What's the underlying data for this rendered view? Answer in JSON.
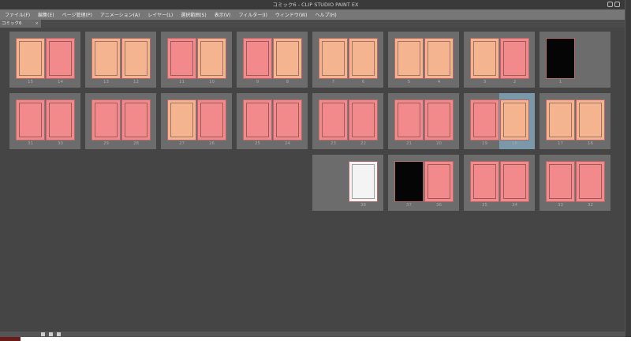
{
  "window": {
    "title": "コミック6 - CLIP STUDIO PAINT EX"
  },
  "menu": [
    "ファイル(F)",
    "編集(E)",
    "ページ管理(P)",
    "アニメーション(A)",
    "レイヤー(L)",
    "選択範囲(S)",
    "表示(V)",
    "フィルター(I)",
    "ウィンドウ(W)",
    "ヘルプ(H)"
  ],
  "tab": {
    "label": "コミック6",
    "close": "×"
  },
  "colors": {
    "pink": "#f28a8c",
    "orange": "#f4b48f",
    "black": "#050505",
    "white": "#f4f4f4",
    "selected": "#7a98aa"
  },
  "rows": [
    [
      [
        {
          "n": "15",
          "c": "orange"
        },
        {
          "n": "14",
          "c": "pink"
        }
      ],
      [
        {
          "n": "13",
          "c": "orange"
        },
        {
          "n": "12",
          "c": "orange"
        }
      ],
      [
        {
          "n": "11",
          "c": "pink"
        },
        {
          "n": "10",
          "c": "orange"
        }
      ],
      [
        {
          "n": "9",
          "c": "pink"
        },
        {
          "n": "8",
          "c": "orange"
        }
      ],
      [
        {
          "n": "7",
          "c": "orange"
        },
        {
          "n": "6",
          "c": "orange"
        }
      ],
      [
        {
          "n": "5",
          "c": "orange"
        },
        {
          "n": "4",
          "c": "orange"
        }
      ],
      [
        {
          "n": "3",
          "c": "orange"
        },
        {
          "n": "2",
          "c": "pink"
        }
      ],
      [
        {
          "n": "1",
          "c": "black"
        },
        null
      ]
    ],
    [
      [
        {
          "n": "31",
          "c": "pink"
        },
        {
          "n": "30",
          "c": "pink"
        }
      ],
      [
        {
          "n": "29",
          "c": "pink"
        },
        {
          "n": "28",
          "c": "pink"
        }
      ],
      [
        {
          "n": "27",
          "c": "orange"
        },
        {
          "n": "26",
          "c": "pink"
        }
      ],
      [
        {
          "n": "25",
          "c": "pink"
        },
        {
          "n": "24",
          "c": "pink"
        }
      ],
      [
        {
          "n": "23",
          "c": "pink"
        },
        {
          "n": "22",
          "c": "pink"
        }
      ],
      [
        {
          "n": "21",
          "c": "pink"
        },
        {
          "n": "20",
          "c": "pink"
        }
      ],
      [
        {
          "n": "19",
          "c": "pink"
        },
        {
          "n": "18",
          "c": "orange",
          "selected": true
        }
      ],
      [
        {
          "n": "17",
          "c": "orange"
        },
        {
          "n": "16",
          "c": "orange"
        }
      ]
    ],
    [
      null,
      null,
      null,
      null,
      [
        null,
        {
          "n": "38",
          "c": "white"
        }
      ],
      [
        {
          "n": "37",
          "c": "black"
        },
        {
          "n": "36",
          "c": "pink"
        }
      ],
      [
        {
          "n": "35",
          "c": "pink"
        },
        {
          "n": "34",
          "c": "pink"
        }
      ],
      [
        {
          "n": "33",
          "c": "pink"
        },
        {
          "n": "32",
          "c": "pink"
        }
      ]
    ]
  ]
}
